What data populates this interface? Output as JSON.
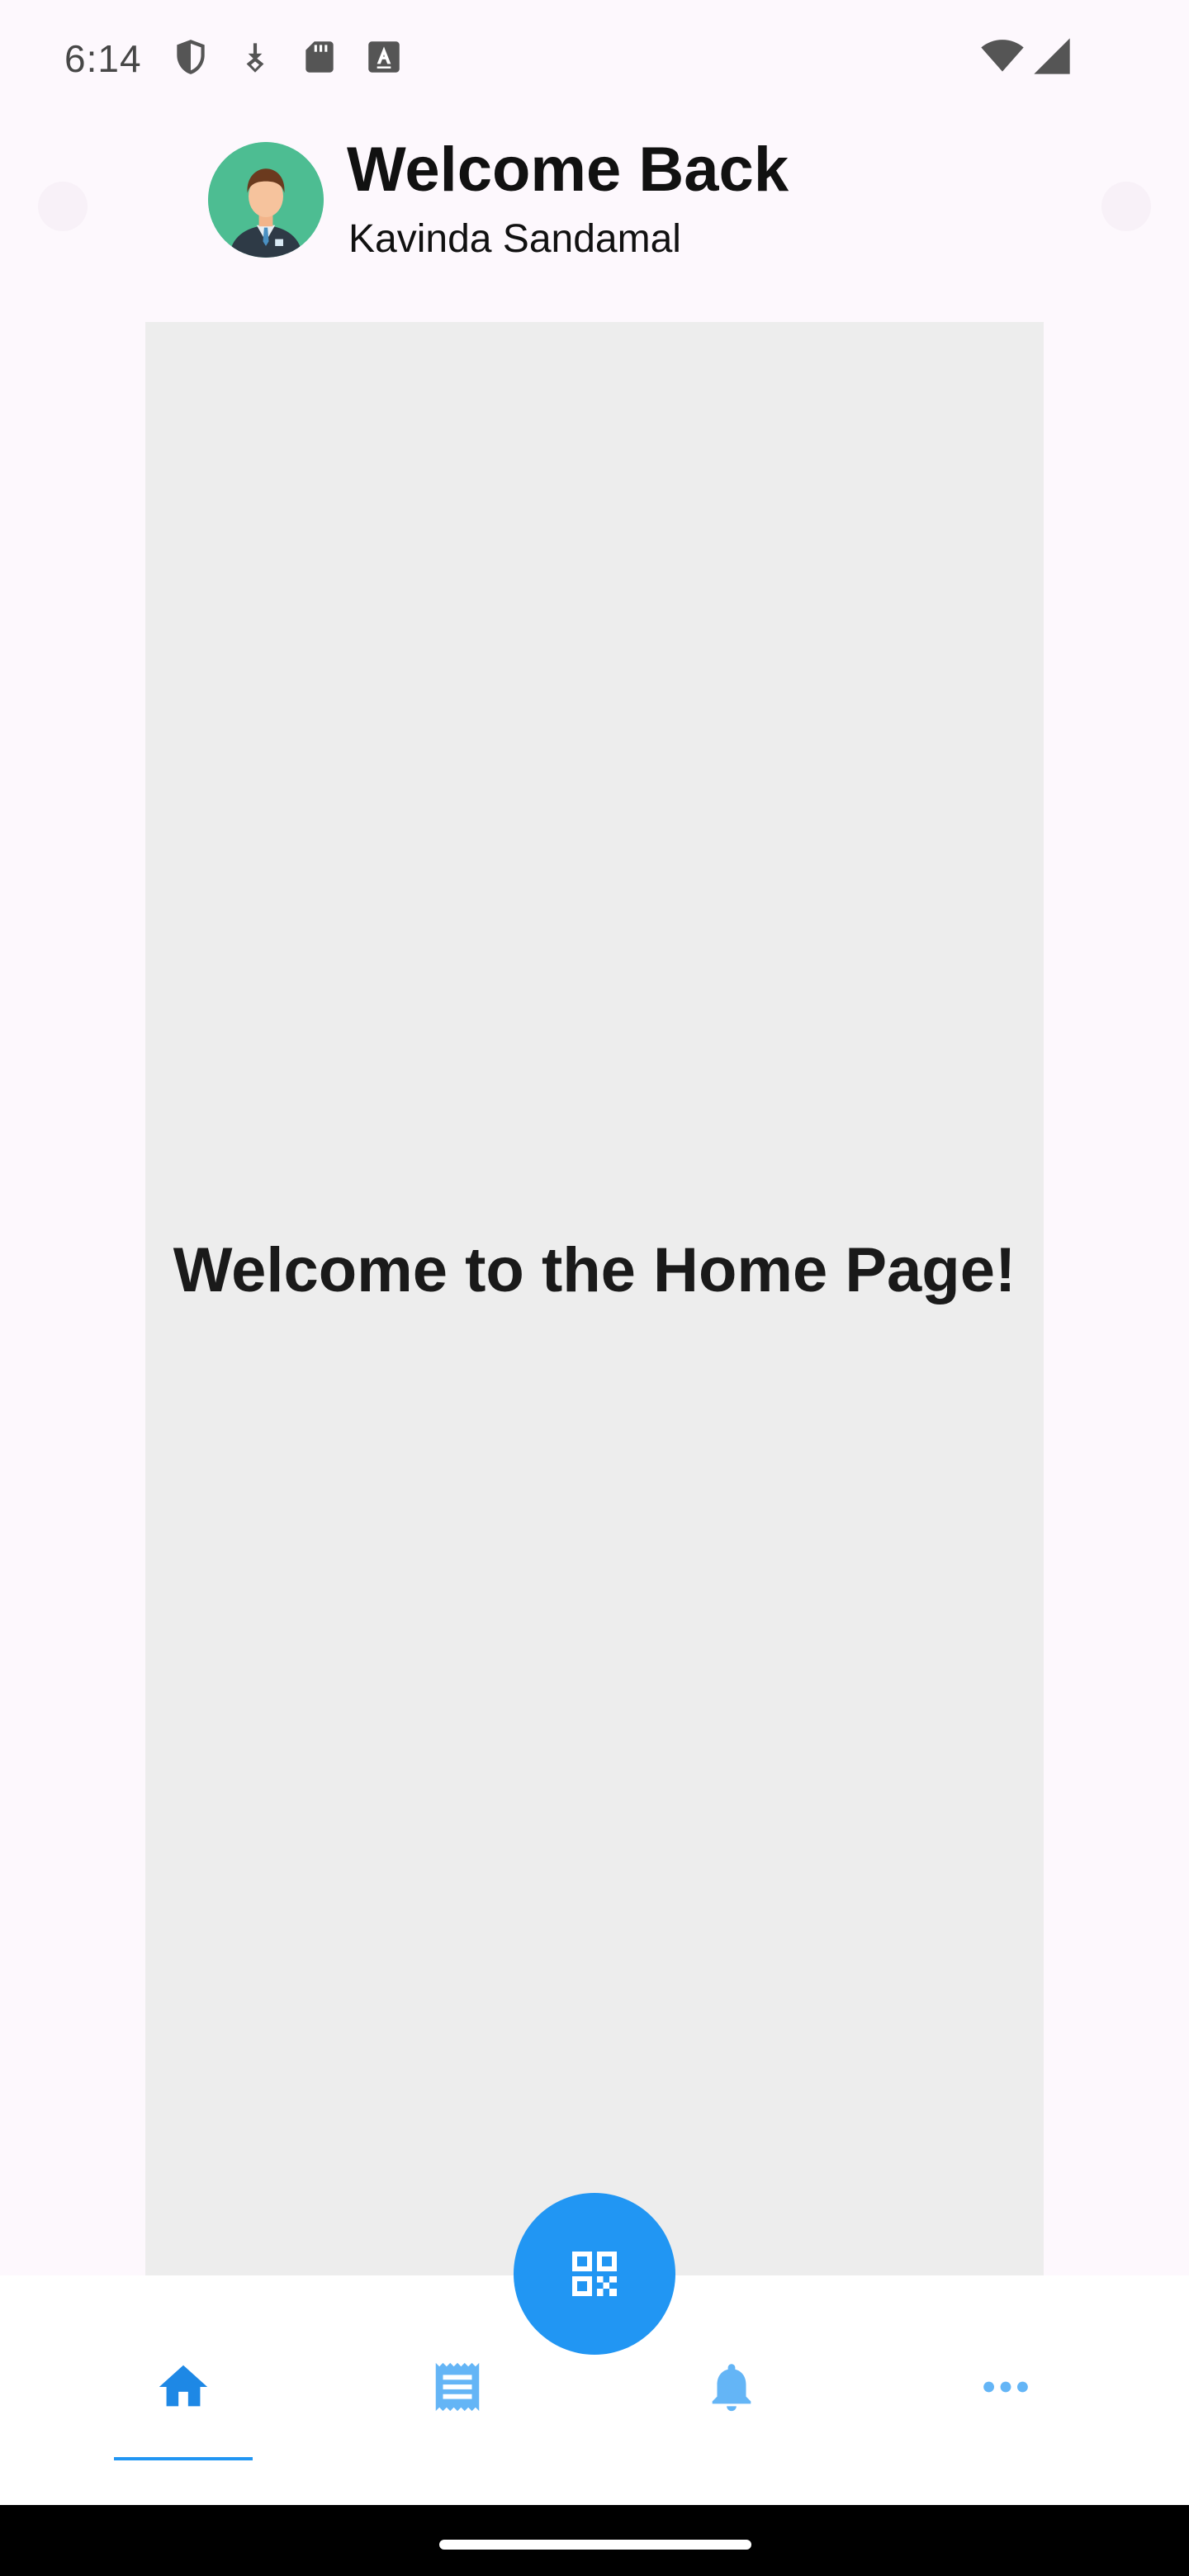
{
  "status_bar": {
    "time": "6:14",
    "left_icons": [
      "shield-icon",
      "download-badge-icon",
      "sd-card-icon",
      "font-a-icon"
    ],
    "right_icons": [
      "wifi-icon",
      "cellular-signal-icon"
    ]
  },
  "header": {
    "greeting": "Welcome Back",
    "user_name": "Kavinda Sandamal",
    "avatar_icon": "user-avatar-icon"
  },
  "main": {
    "message": "Welcome to the Home Page!"
  },
  "bottom_nav": {
    "items": [
      {
        "icon": "home-icon",
        "active": true
      },
      {
        "icon": "receipt-icon",
        "active": false
      },
      {
        "icon": "bell-icon",
        "active": false
      },
      {
        "icon": "more-horizontal-icon",
        "active": false
      }
    ],
    "fab_icon": "qr-code-icon"
  },
  "colors": {
    "accent": "#2196f3",
    "accent_light": "#64b5f6",
    "avatar_bg": "#4dbd92",
    "panel_bg": "#ededed",
    "page_bg": "#fdf8fd"
  }
}
